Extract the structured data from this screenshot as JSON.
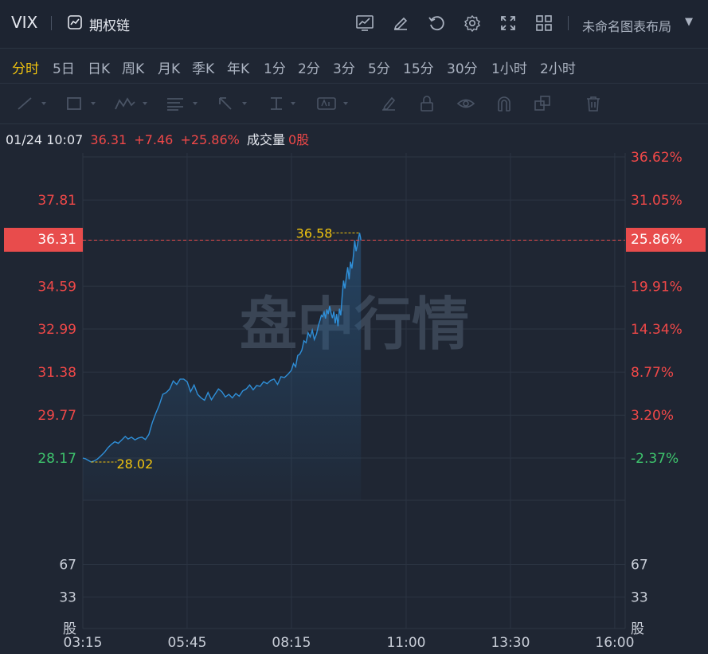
{
  "header": {
    "symbol": "VIX",
    "option_chain_label": "期权链",
    "layout_label": "未命名图表布局",
    "icons": [
      "chart-line-icon",
      "edit-icon",
      "refresh-icon",
      "gear-icon",
      "fullscreen-icon",
      "grid-layout-icon"
    ]
  },
  "periods": {
    "active": "分时",
    "items": [
      "分时",
      "5日",
      "日K",
      "周K",
      "月K",
      "季K",
      "年K",
      "1分",
      "2分",
      "3分",
      "5分",
      "15分",
      "30分",
      "1小时",
      "2小时"
    ]
  },
  "drawing_tools": [
    "line-tool-icon",
    "rectangle-tool-icon",
    "pattern-tool-icon",
    "fibonacci-tool-icon",
    "arrow-tool-icon",
    "measure-tool-icon",
    "text-tool-icon",
    "brush-icon",
    "lock-icon",
    "eye-icon",
    "magnet-icon",
    "layers-icon",
    "trash-icon"
  ],
  "quote": {
    "datetime": "01/24 10:07",
    "price": "36.31",
    "change": "+7.46",
    "change_pct": "+25.86%",
    "volume_label": "成交量",
    "volume_value": "0股"
  },
  "colors": {
    "background": "#1f2633",
    "line": "#2f8fd8",
    "up": "#f04848",
    "down": "#3ec46d",
    "highlight": "#f1c40f"
  },
  "chart_data": {
    "type": "line",
    "watermark": "盘中行情",
    "current_price": 36.31,
    "current_pct": "25.86%",
    "prev_close": 28.17,
    "ylim": [
      26.57,
      39.42
    ],
    "left_ticks": [
      37.81,
      36.31,
      34.59,
      32.99,
      31.38,
      29.77,
      28.17
    ],
    "right_ticks": [
      "36.62%",
      "31.05%",
      "25.86%",
      "19.91%",
      "14.34%",
      "8.77%",
      "3.20%",
      "-2.37%"
    ],
    "right_tick_values": [
      39.42,
      37.81,
      36.31,
      34.59,
      32.99,
      31.38,
      29.77,
      28.17
    ],
    "max_label": "36.58",
    "min_label": "28.02",
    "max_value": 36.58,
    "min_value": 28.02,
    "volume_ticks": [
      "67",
      "33",
      "股"
    ],
    "volume_tick_values": [
      67,
      33,
      0
    ],
    "x_ticks": [
      "03:15",
      "05:45",
      "08:15",
      "11:00",
      "13:30",
      "16:00"
    ],
    "x_tick_minutes": [
      195,
      345,
      495,
      660,
      810,
      960
    ],
    "series": [
      {
        "x": [
          195,
          199,
          203,
          207,
          211,
          216,
          221,
          226,
          231,
          236,
          241,
          246,
          251,
          256,
          260,
          265,
          270,
          275,
          280,
          285,
          290,
          295,
          300,
          305,
          310,
          315,
          320,
          325,
          330,
          335,
          340,
          345,
          350,
          355,
          360,
          365,
          370,
          375,
          380,
          385,
          390,
          395,
          400,
          405,
          410,
          415,
          420,
          425,
          430,
          435,
          440,
          445,
          450,
          455,
          460,
          465,
          470,
          475,
          480,
          485,
          490,
          495,
          498,
          501,
          504,
          507,
          510,
          513,
          516,
          519,
          522,
          525,
          528,
          531,
          534,
          536,
          538,
          540,
          542,
          544,
          546,
          548,
          550,
          552,
          554,
          556,
          558,
          560,
          562,
          564,
          566,
          568,
          570,
          572,
          574,
          576,
          578,
          580,
          582,
          584,
          586,
          588,
          590,
          592,
          593,
          594,
          595
        ],
        "y": [
          28.17,
          28.14,
          28.08,
          28.02,
          28.06,
          28.13,
          28.25,
          28.38,
          28.55,
          28.68,
          28.78,
          28.72,
          28.85,
          28.98,
          28.88,
          28.95,
          28.85,
          28.92,
          28.95,
          28.86,
          29.05,
          29.5,
          29.85,
          30.15,
          30.55,
          30.62,
          30.75,
          31.05,
          30.92,
          31.12,
          31.12,
          31.02,
          30.65,
          30.9,
          30.55,
          30.42,
          30.33,
          30.62,
          30.35,
          30.55,
          30.75,
          30.65,
          30.45,
          30.55,
          30.42,
          30.58,
          30.48,
          30.68,
          30.75,
          30.9,
          30.72,
          30.88,
          30.85,
          31.02,
          30.95,
          31.07,
          31.12,
          30.92,
          31.21,
          31.18,
          31.3,
          31.45,
          31.7,
          31.58,
          32.0,
          32.05,
          32.2,
          32.55,
          32.48,
          32.85,
          32.7,
          32.95,
          32.6,
          32.8,
          33.15,
          33.3,
          33.5,
          33.45,
          33.62,
          33.38,
          33.72,
          33.55,
          33.85,
          33.58,
          33.4,
          33.65,
          33.2,
          33.55,
          33.1,
          33.75,
          33.5,
          34.25,
          34.8,
          34.5,
          34.95,
          35.3,
          34.85,
          35.5,
          35.25,
          35.7,
          36.3,
          35.9,
          36.15,
          36.45,
          36.58,
          36.45,
          36.31
        ]
      }
    ]
  }
}
